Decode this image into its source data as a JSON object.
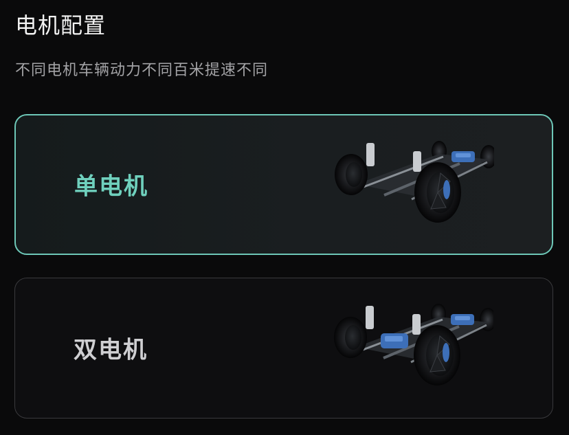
{
  "header": {
    "title": "电机配置",
    "subtitle": "不同电机车辆动力不同百米提速不同"
  },
  "options": [
    {
      "label": "单电机",
      "selected": true,
      "image_icon": "single-motor-chassis-image"
    },
    {
      "label": "双电机",
      "selected": false,
      "image_icon": "dual-motor-chassis-image"
    }
  ],
  "colors": {
    "accent": "#6ec8b8",
    "selected_label": "#6fd0bd",
    "unselected_label": "#cfcfd2",
    "background": "#0a0a0b"
  }
}
